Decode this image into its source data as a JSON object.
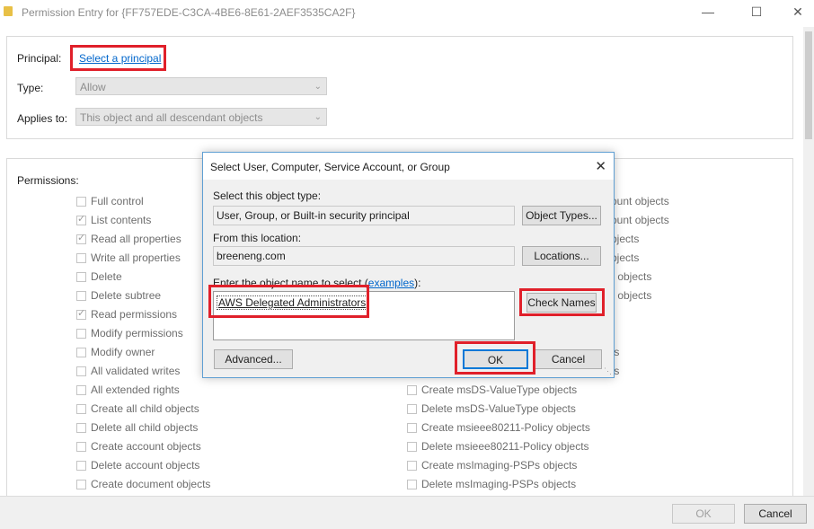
{
  "window": {
    "title": "Permission Entry for {FF757EDE-C3CA-4BE6-8E61-2AEF3535CA2F}",
    "icon": "folder-icon",
    "minimize_glyph": "—",
    "maximize_glyph": "☐",
    "close_glyph": "✕"
  },
  "principal": {
    "label": "Principal:",
    "link": "Select a principal"
  },
  "type": {
    "label": "Type:",
    "value": "Allow"
  },
  "applies_to": {
    "label": "Applies to:",
    "value": "This object and all descendant objects"
  },
  "permissions": {
    "label": "Permissions:",
    "left": [
      {
        "label": "Full control",
        "checked": false
      },
      {
        "label": "List contents",
        "checked": true
      },
      {
        "label": "Read all properties",
        "checked": true
      },
      {
        "label": "Write all properties",
        "checked": false
      },
      {
        "label": "Delete",
        "checked": false
      },
      {
        "label": "Delete subtree",
        "checked": false
      },
      {
        "label": "Read permissions",
        "checked": true
      },
      {
        "label": "Modify permissions",
        "checked": false
      },
      {
        "label": "Modify owner",
        "checked": false
      },
      {
        "label": "All validated writes",
        "checked": false
      },
      {
        "label": "All extended rights",
        "checked": false
      },
      {
        "label": "Create all child objects",
        "checked": false
      },
      {
        "label": "Delete all child objects",
        "checked": false
      },
      {
        "label": "Create account objects",
        "checked": false
      },
      {
        "label": "Delete account objects",
        "checked": false
      },
      {
        "label": "Create document objects",
        "checked": false
      }
    ],
    "right_partial": [
      "ount objects",
      "ount objects",
      "bjects",
      "bjects",
      "r objects",
      "r objects",
      "ts",
      "ts"
    ],
    "right": [
      {
        "label": "Create msDS-ValueType objects",
        "checked": false
      },
      {
        "label": "Delete msDS-ValueType objects",
        "checked": false
      },
      {
        "label": "Create msieee80211-Policy objects",
        "checked": false
      },
      {
        "label": "Delete msieee80211-Policy objects",
        "checked": false
      },
      {
        "label": "Create msImaging-PSPs objects",
        "checked": false
      },
      {
        "label": "Delete msImaging-PSPs objects",
        "checked": false
      }
    ]
  },
  "footer": {
    "ok_label": "OK",
    "cancel_label": "Cancel"
  },
  "dialog": {
    "title": "Select User, Computer, Service Account, or Group",
    "close_glyph": "✕",
    "object_type_label": "Select this object type:",
    "object_type_value": "User, Group, or Built-in security principal",
    "object_types_button": "Object Types...",
    "location_label": "From this location:",
    "location_value": "breeneng.com",
    "locations_button": "Locations...",
    "name_label_prefix": "Enter the object name to select (",
    "name_label_link": "examples",
    "name_label_suffix": "):",
    "name_value": "AWS Delegated Administrators",
    "check_names_button": "Check Names",
    "advanced_button": "Advanced...",
    "ok_button": "OK",
    "cancel_button": "Cancel"
  },
  "colors": {
    "highlight_red": "#e0202a",
    "link_blue": "#0066cc",
    "dialog_border": "#5f9fd3"
  }
}
